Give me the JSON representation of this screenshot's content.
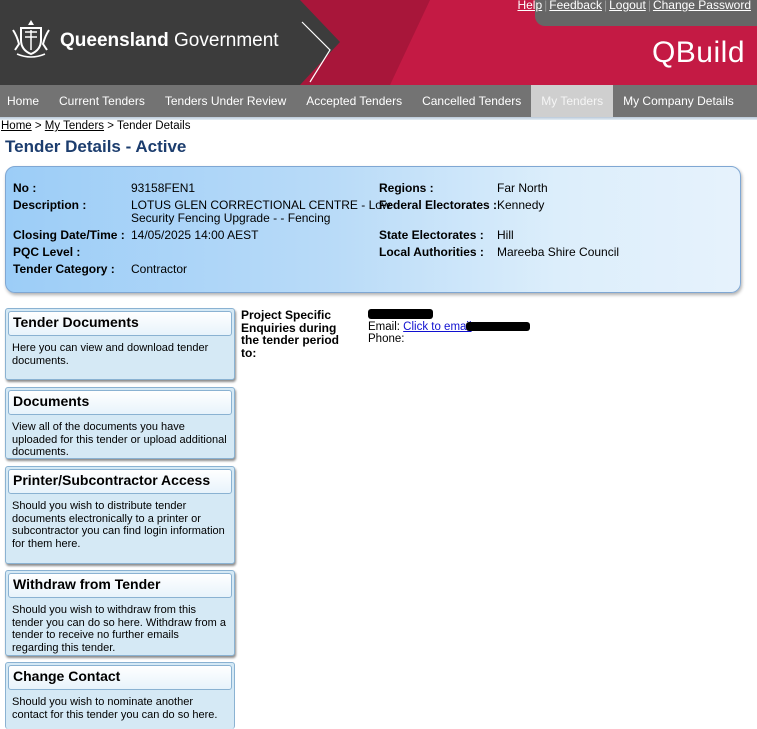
{
  "header": {
    "links": [
      "Help",
      "Feedback",
      "Logout",
      "Change Password"
    ],
    "gov_name_bold": "Queensland",
    "gov_name_rest": " Government",
    "app_title": "QBuild"
  },
  "nav": {
    "items": [
      "Home",
      "Current Tenders",
      "Tenders Under Review",
      "Accepted Tenders",
      "Cancelled Tenders",
      "My Tenders",
      "My Company Details"
    ],
    "active": "My Tenders"
  },
  "breadcrumb": {
    "home": "Home",
    "sep1": " > ",
    "my_tenders": "My Tenders",
    "sep2": " > ",
    "current": "Tender Details"
  },
  "page_title": "Tender Details - Active",
  "details": {
    "no_label": "No :",
    "no": "93158FEN1",
    "description_label": "Description :",
    "description_line1": "LOTUS GLEN CORRECTIONAL CENTRE - Low",
    "description_line2": "Security Fencing Upgrade - - Fencing",
    "closing_label": "Closing Date/Time :",
    "closing": "14/05/2025 14:00 AEST",
    "pqc_label": "PQC Level :",
    "pqc": "",
    "category_label": "Tender Category :",
    "category": "Contractor",
    "regions_label": "Regions :",
    "regions": "Far North",
    "federal_label": "Federal Electorates :",
    "federal": "Kennedy",
    "state_label": "State Electorates :",
    "state": "Hill",
    "local_label": "Local Authorities :",
    "local": "Mareeba Shire Council"
  },
  "cards": [
    {
      "title": "Tender Documents",
      "text": "Here you can view and download tender documents."
    },
    {
      "title": "Documents",
      "text": "View all of the documents you have uploaded for this tender or upload additional documents."
    },
    {
      "title": "Printer/Subcontractor Access",
      "text": "Should you wish to distribute tender documents electronically to a printer or subcontractor you can find login information for them here."
    },
    {
      "title": "Withdraw from Tender",
      "text": "Should you wish to withdraw from this tender you can do so here. Withdraw from a tender to receive no further emails regarding this tender."
    },
    {
      "title": "Change Contact",
      "text": "Should you wish to nominate another contact for this tender you can do so here."
    }
  ],
  "contact": {
    "enquiries_label": "Project Specific Enquiries during the tender period to:",
    "email_label": "Email:",
    "email_link": "Click to email",
    "phone_label": "Phone:",
    "phone": ""
  },
  "colors": {
    "nav_bg": "#737373",
    "title": "#1c3d6e",
    "accent_red": "#c41a44",
    "link": "#1010d0"
  }
}
